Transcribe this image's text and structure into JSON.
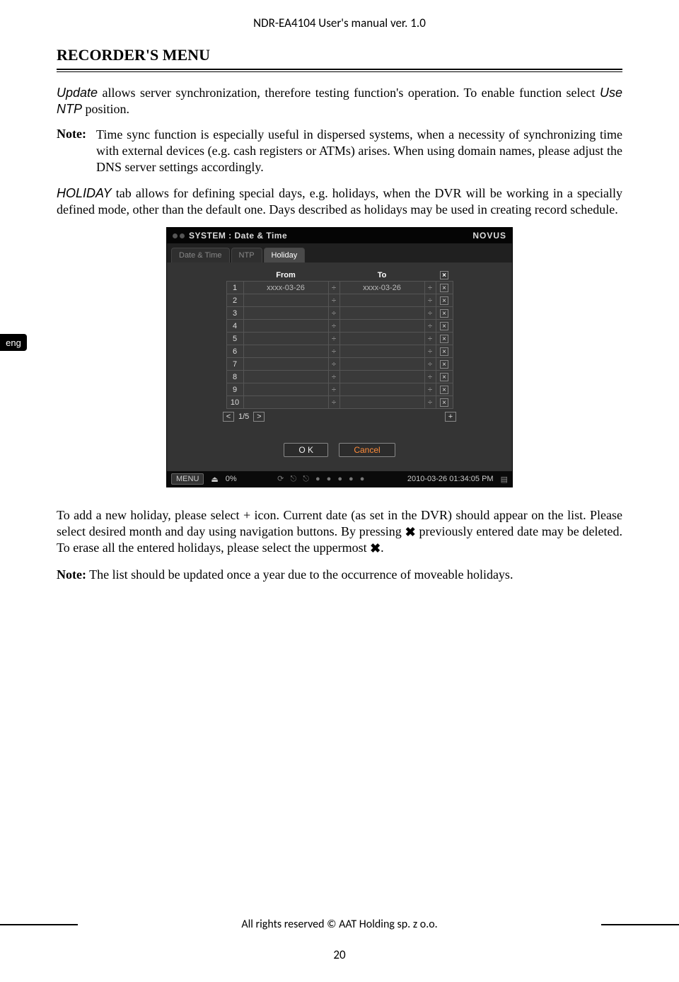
{
  "header": {
    "title": "NDR-EA4104 User's manual ver. 1.0"
  },
  "section_title": "RECORDER'S MENU",
  "lang_tab": "eng",
  "para1": {
    "lead": "Update",
    "rest1": " allows server synchronization, therefore testing function's operation. To enable function select ",
    "lead2": "Use NTP",
    "rest2": " position."
  },
  "note1": {
    "label": "Note:",
    "body": "Time sync function is especially useful in dispersed systems, when a necessity of synchronizing time with external devices (e.g. cash registers or ATMs) arises. When using domain names, please adjust the DNS server settings accordingly."
  },
  "para2": {
    "lead": "HOLIDAY",
    "rest": " tab allows for defining special days, e.g. holidays, when the DVR will be working in a specially defined mode, other than the default one. Days described as holidays may be used in creating record schedule."
  },
  "dvr": {
    "title": "SYSTEM : Date & Time",
    "brand_left": "NO",
    "brand_mid": "V",
    "brand_right": "US",
    "tabs": [
      "Date & Time",
      "NTP",
      "Holiday"
    ],
    "active_tab": 2,
    "col_from": "From",
    "col_to": "To",
    "rows": [
      {
        "n": "1",
        "from": "xxxx-03-26",
        "to": "xxxx-03-26"
      },
      {
        "n": "2",
        "from": "",
        "to": ""
      },
      {
        "n": "3",
        "from": "",
        "to": ""
      },
      {
        "n": "4",
        "from": "",
        "to": ""
      },
      {
        "n": "5",
        "from": "",
        "to": ""
      },
      {
        "n": "6",
        "from": "",
        "to": ""
      },
      {
        "n": "7",
        "from": "",
        "to": ""
      },
      {
        "n": "8",
        "from": "",
        "to": ""
      },
      {
        "n": "9",
        "from": "",
        "to": ""
      },
      {
        "n": "10",
        "from": "",
        "to": ""
      }
    ],
    "page_ind": "1/5",
    "ok": "O K",
    "cancel": "Cancel",
    "status": {
      "menu": "MENU",
      "pct": "0%",
      "timestamp": "2010-03-26 01:34:05 PM"
    }
  },
  "para3": {
    "p1": "To add a new holiday, please select + icon. Current date (as set in the DVR) should appear on the list. Please select desired month and day using navigation buttons. By pressing ",
    "p2": " previously entered date may be deleted. To erase all the entered holidays, please select the  uppermost ",
    "p3": "."
  },
  "note2": {
    "label": "Note:",
    "body": " The list should be updated once a year due to the occurrence of moveable  holidays."
  },
  "footer": "All rights reserved © AAT Holding sp. z o.o.",
  "page_number": "20"
}
